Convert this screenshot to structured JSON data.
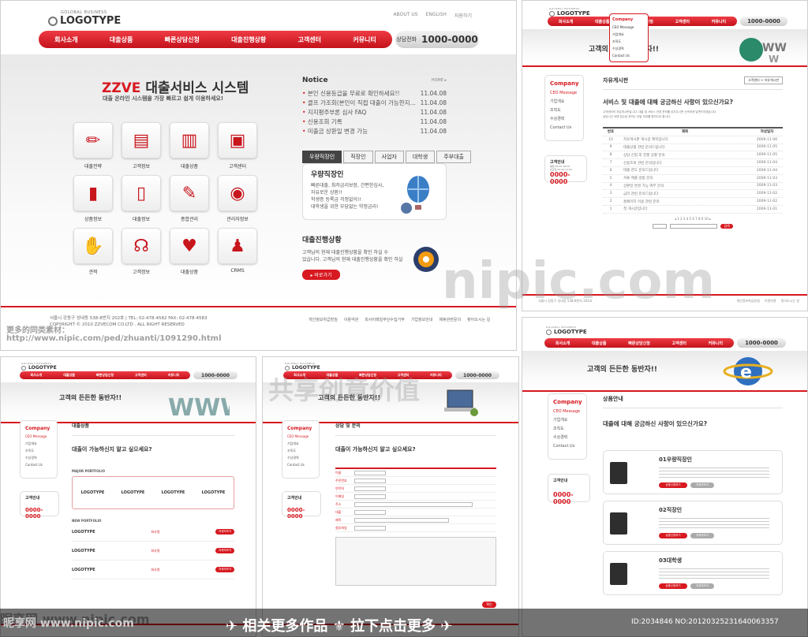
{
  "main": {
    "logo_sub": "GOLOBAL BUSINESS",
    "logo": "LOGOTYPE",
    "toplinks": [
      "ABOUT US",
      "ENGLISH",
      "지원하기"
    ],
    "nav": [
      "회사소개",
      "대출상품",
      "빠른상담신청",
      "대출진행상황",
      "고객센터",
      "커뮤니티"
    ],
    "phone_label": "상담전화",
    "phone": "1000-0000",
    "hero_brand": "ZZVE",
    "hero_title": "대출서비스 시스템",
    "hero_sub": "대출 온라인 시스템을 가장 빠르고 쉽게 이용하세요!",
    "tiles": [
      {
        "icon": "✏",
        "label": "대출전략"
      },
      {
        "icon": "▤",
        "label": "고객정보"
      },
      {
        "icon": "▥",
        "label": "대출상품"
      },
      {
        "icon": "▣",
        "label": "고객센터"
      },
      {
        "icon": "▮",
        "label": "상품정보"
      },
      {
        "icon": "▯",
        "label": "대출정보"
      },
      {
        "icon": "✎",
        "label": "종합관리"
      },
      {
        "icon": "◉",
        "label": "관리자정보"
      },
      {
        "icon": "✋",
        "label": "견적"
      },
      {
        "icon": "☊",
        "label": "고객정보"
      },
      {
        "icon": "♥",
        "label": "대출상품"
      },
      {
        "icon": "♟",
        "label": "CRMS"
      }
    ],
    "notice_title": "Notice",
    "notice_more": "HOME ▸",
    "notices": [
      {
        "t": "본인 신용등급을 무료로 확인하세요!!",
        "d": "11.04.08"
      },
      {
        "t": "클프 가조회(본인이 직접 대출이 가능한지...",
        "d": "11.04.08"
      },
      {
        "t": "지지평주부론 심사 FAQ",
        "d": "11.04.08"
      },
      {
        "t": "신용조회 기록",
        "d": "11.04.08"
      },
      {
        "t": "미출금 상환일 변경 가능",
        "d": "11.04.08"
      }
    ],
    "tabs": [
      "우량직장인",
      "직장인",
      "사업자",
      "대학생",
      "주부대출"
    ],
    "promo_title": "우량직장인",
    "promo_lines": [
      "빠른대출, 최저금리보장, 간편한심사,",
      "자유로운 상환!!",
      "학생증 등록금 걱정없이!!",
      "대학생을 위한 부담없는 약정금리!"
    ],
    "progress_title": "대출진행상황",
    "progress_lines": [
      "고객님의 현재 대출진행상황을 확인 하실 수",
      "있습니다. 고객님의 현재 대출진행상황을 확인 하실"
    ],
    "progress_btn": "바로가기",
    "footer_addr": "서울시 강동구 성내동 538-8번지 202호 | TEL: 02-478-4582  FAX: 02-478-4583",
    "footer_copy": "COPYRIGHT © 2010 ZZVECOM CO.LTD . ALL RIGHT RESERVED",
    "footer_links": [
      "개인정보취급방침",
      "이용약관",
      "회사이메일무단수집거부",
      "기업정보안내",
      "제휴관련문의",
      "찾아오시는 길"
    ]
  },
  "board": {
    "nav": [
      "회사소개",
      "대출상품",
      "빠른상담신청",
      "고객센터",
      "커뮤니티"
    ],
    "phone": "1000-0000",
    "dropdown": [
      "Company",
      "CEO Message",
      "기업개요",
      "조직도",
      "수상경력",
      "Contact Us"
    ],
    "banner": "고객의 든든한 동반자!!",
    "side_title": "Company",
    "side_items": [
      "CEO Message",
      "기업개요",
      "조직도",
      "수상경력",
      "Contact Us"
    ],
    "info_title": "고객안내",
    "info_lines": [
      "평일 09:00-18:00",
      "토요일 09:00-13:00"
    ],
    "info_phone": "0000-0000",
    "page_title": "자유게시판",
    "crumb": "고객센터 > 자유게시판",
    "question": "서비스 및 대출에 대해 궁금하신 사항이 있으신가요?",
    "intro": [
      "고객센터의 자유게시판입니다. 대출 및 서비스 관련 문의를 남겨주시면 신속하게 답변드리겠습니다.",
      "상담시간 내에 접수된 문의는 당일 처리를 원칙으로 합니다."
    ],
    "cols": [
      "번호",
      "제목",
      "작성일자"
    ],
    "rows": [
      {
        "n": "10",
        "t": "자유게시판 게시글 제목입니다",
        "d": "2009-11-06"
      },
      {
        "n": "9",
        "t": "대출상품 관련 문의드립니다",
        "d": "2009-11-05"
      },
      {
        "n": "8",
        "t": "상담 신청 후 진행 상황 문의",
        "d": "2009-11-05"
      },
      {
        "n": "7",
        "t": "신용조회 관련 문의입니다",
        "d": "2009-11-04"
      },
      {
        "n": "6",
        "t": "대출 한도 문의드립니다",
        "d": "2009-11-04"
      },
      {
        "n": "5",
        "t": "서류 제출 방법 문의",
        "d": "2009-11-03"
      },
      {
        "n": "4",
        "t": "상환일 변경 가능 여부 문의",
        "d": "2009-11-03"
      },
      {
        "n": "3",
        "t": "금리 관련 문의드립니다",
        "d": "2009-11-02"
      },
      {
        "n": "2",
        "t": "홈페이지 이용 관련 문의",
        "d": "2009-11-02"
      },
      {
        "n": "1",
        "t": "첫 게시글입니다",
        "d": "2009-11-01"
      }
    ],
    "pages": "◂ 1 2 3 4 5 6 7 8 9 10 ▸",
    "search_btn": "검색",
    "footer_addr": "서울시 강동구 성내동 538-8번지 202호",
    "footer_links": [
      "개인정보취급방침",
      "이용약관",
      "찾아오시는 길"
    ]
  },
  "portfolio": {
    "banner": "고객의 든든한 동반자!!",
    "page_title": "대출상품",
    "question": "대출이 가능하신지 알고 싶으세요?",
    "major": "MAJOR PORTFOLIO",
    "new": "NEW PORTFOLIO",
    "logos": [
      "LOGOTYPE",
      "LOGOTYPE",
      "LOGOTYPE",
      "LOGOTYPE"
    ],
    "items": [
      {
        "c": "회사명"
      },
      {
        "c": "회사명"
      },
      {
        "c": "회사명"
      }
    ],
    "btn": "자세히보기",
    "phone": "1000-0000",
    "info_phone": "0000-0000"
  },
  "form": {
    "banner": "고객의 든든한 동반자!!",
    "page_title": "상담 및 문의",
    "question": "대출이 가능하신지 알고 싶으세요?",
    "fields": [
      "이름",
      "주민번호",
      "연락처",
      "이메일",
      "주소",
      "대출",
      "제목",
      "첨부파일"
    ],
    "btn": "확인",
    "phone": "1000-0000",
    "info_phone": "0000-0000"
  },
  "products": {
    "banner": "고객의 든든한 동반자!!",
    "page_title": "상품안내",
    "question": "대출에 대해 궁금하신 사항이 있으신가요?",
    "cards": [
      {
        "num": "01",
        "name": "우량직장인"
      },
      {
        "num": "02",
        "name": "직장인"
      },
      {
        "num": "03",
        "name": "대학생"
      }
    ],
    "btn1": "상품신청하기",
    "btn2": "자세히보기",
    "phone": "1000-0000",
    "info_phone": "0000-0000"
  },
  "watermarks": {
    "big": "nipic.com",
    "cn": "昵享网 www.nipic.com",
    "mid": "共享创意价值",
    "more": "更多的同类素材：",
    "url": "http://www.nipic.com/ped/zhuanti/1091290.html",
    "bottom": "✈ 相关更多作品  ⚜  拉下点击更多 ✈",
    "id": "ID:2034846 NO:20120325231640063357"
  },
  "colors": {
    "accent": "#d71920"
  }
}
